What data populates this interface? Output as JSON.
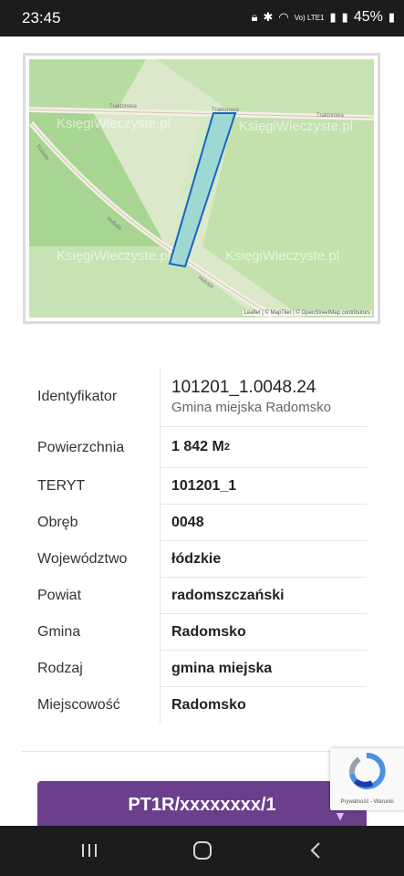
{
  "status_bar": {
    "time": "23:45",
    "network": "Vo) LTE1",
    "battery": "45%"
  },
  "map": {
    "watermarks": [
      "KsięgiWieczyste.pl",
      "KsięgiWieczyste.pl",
      "KsięgiWieczyste.pl",
      "KsięgiWieczyste.pl"
    ],
    "road_labels": [
      "Traktorowa",
      "Traktorowa",
      "Traktorowa",
      "Hubala",
      "Hubala",
      "Hubala"
    ],
    "attribution": "Leaflet | © MapTiler | © OpenStreetMap contributors",
    "parcel_color": "#1565c0",
    "parcel_fill": "#9fd8d2"
  },
  "details": {
    "identifier_label": "Identyfikator",
    "identifier_value": "101201_1.0048.24",
    "identifier_sub": "Gmina miejska Radomsko",
    "area_label": "Powierzchnia",
    "area_value": "1 842 M",
    "area_unit_sup": "2",
    "teryt_label": "TERYT",
    "teryt_value": "101201_1",
    "obreb_label": "Obręb",
    "obreb_value": "0048",
    "wojewodztwo_label": "Województwo",
    "wojewodztwo_value": "łódzkie",
    "powiat_label": "Powiat",
    "powiat_value": "radomszczański",
    "gmina_label": "Gmina",
    "gmina_value": "Radomsko",
    "rodzaj_label": "Rodzaj",
    "rodzaj_value": "gmina miejska",
    "miejscowosc_label": "Miejscowość",
    "miejscowosc_value": "Radomsko"
  },
  "cta": {
    "label": "PT1R/xxxxxxxx/1",
    "color": "#6b3f8c"
  },
  "recaptcha": {
    "label": "Prywatność - Warunki"
  },
  "nav": {
    "recent_icon": "recent-apps-icon",
    "home_icon": "home-icon",
    "back_icon": "back-icon"
  }
}
